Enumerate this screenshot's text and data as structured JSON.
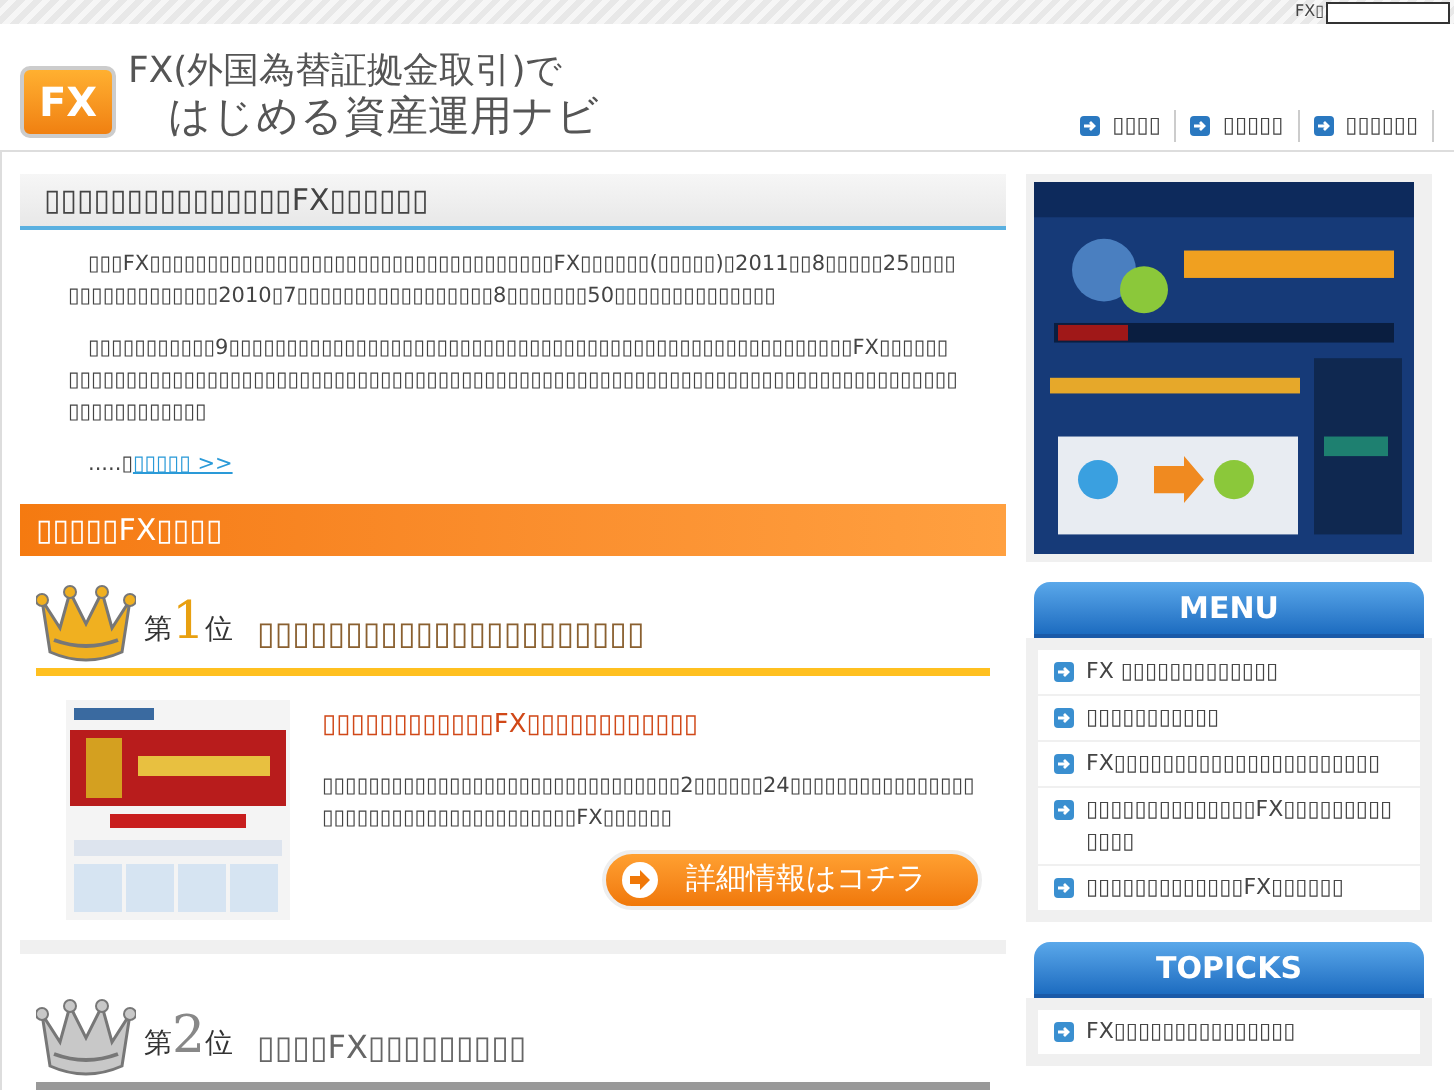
{
  "top_bar": {
    "search_label": "FX▯"
  },
  "header": {
    "logo_badge": "FX",
    "logo_line_1": "FX(外国為替証拠金取引)で",
    "logo_line_2": "はじめる資産運用ナビ",
    "nav": [
      "▯▯▯▯",
      "▯▯▯▯▯",
      "▯▯▯▯▯▯"
    ]
  },
  "intro": {
    "title": "▯▯▯▯▯▯▯▯▯▯▯▯▯▯▯FX▯▯▯▯▯▯",
    "paragraphs": [
      "▯▯▯FX▯▯▯▯▯▯▯▯▯▯▯▯▯▯▯▯▯▯▯▯▯▯▯▯▯▯▯▯▯▯▯▯▯▯▯FX▯▯▯▯▯▯(▯▯▯▯▯)▯2011▯▯8▯▯▯▯▯25▯▯▯▯▯▯▯▯▯▯▯▯▯▯▯▯▯2010▯7▯▯▯▯▯▯▯▯▯▯▯▯▯▯▯▯▯8▯▯▯▯▯▯▯50▯▯▯▯▯▯▯▯▯▯▯▯▯▯",
      "▯▯▯▯▯▯▯▯▯▯▯9▯▯▯▯▯▯▯▯▯▯▯▯▯▯▯▯▯▯▯▯▯▯▯▯▯▯▯▯▯▯▯▯▯▯▯▯▯▯▯▯▯▯▯▯▯▯▯▯▯▯▯▯▯▯FX▯▯▯▯▯▯▯▯▯▯▯▯▯▯▯▯▯▯▯▯▯▯▯▯▯▯▯▯▯▯▯▯▯▯▯▯▯▯▯▯▯▯▯▯▯▯▯▯▯▯▯▯▯▯▯▯▯▯▯▯▯▯▯▯▯▯▯▯▯▯▯▯▯▯▯▯▯▯▯▯▯▯▯▯▯▯▯▯▯▯▯▯▯▯▯"
    ],
    "more_prefix": ".....▯",
    "more_link": "▯▯▯▯▯ >>"
  },
  "ranking": {
    "banner": "▯▯▯▯▯FX▯▯▯▯",
    "entries": [
      {
        "color": "#f0b020",
        "rank_prefix": "第",
        "rank": "1",
        "rank_suffix": "位",
        "name": "▯▯▯▯▯▯▯▯▯▯▯▯▯▯▯▯▯▯▯▯▯▯",
        "headline": "▯▯▯▯▯▯▯▯▯▯▯▯FX▯▯▯▯▯▯▯▯▯▯▯▯",
        "description": "▯▯▯▯▯▯▯▯▯▯▯▯▯▯▯▯▯▯▯▯▯▯▯▯▯▯▯▯▯▯▯2▯▯▯▯▯▯24▯▯▯▯▯▯▯▯▯▯▯▯▯▯▯▯▯▯▯▯▯▯▯▯▯▯▯▯▯▯▯▯▯▯▯▯▯▯FX▯▯▯▯▯▯",
        "button": "詳細情報はコチラ"
      },
      {
        "color": "#c8c8c8",
        "rank_prefix": "第",
        "rank": "2",
        "rank_suffix": "位",
        "name": "▯▯▯▯FX▯▯▯▯▯▯▯▯▯"
      }
    ]
  },
  "sidebar": {
    "menu": {
      "title": "MENU",
      "items": [
        "FX ▯▯▯▯▯▯▯▯▯▯▯▯▯",
        "▯▯▯▯▯▯▯▯▯▯▯",
        "FX▯▯▯▯▯▯▯▯▯▯▯▯▯▯▯▯▯▯▯▯▯▯",
        "▯▯▯▯▯▯▯▯▯▯▯▯▯▯FX▯▯▯▯▯▯▯▯▯▯▯▯▯",
        "▯▯▯▯▯▯▯▯▯▯▯▯▯FX▯▯▯▯▯▯"
      ]
    },
    "topics": {
      "title": "TOPICKS",
      "items": [
        "FX▯▯▯▯▯▯▯▯▯▯▯▯▯▯▯"
      ]
    }
  }
}
